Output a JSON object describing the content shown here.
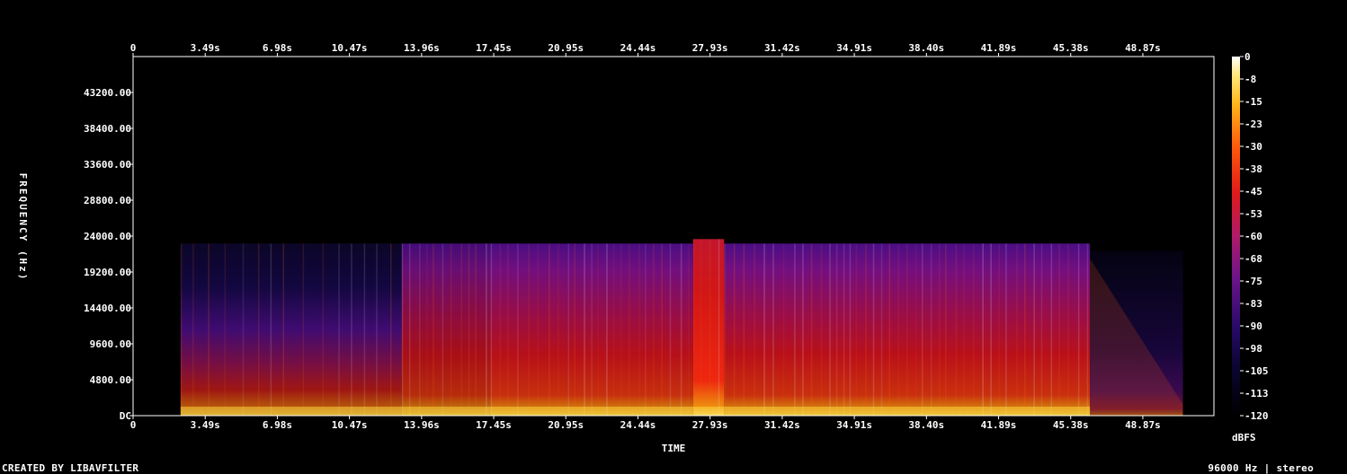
{
  "chart_data": {
    "type": "heatmap",
    "title": "",
    "xlabel": "TIME",
    "ylabel": "FREQUENCY (Hz)",
    "colorbar_label": "dBFS",
    "x_top_ticks": [
      "0",
      "3.49s",
      "6.98s",
      "10.47s",
      "13.96s",
      "17.45s",
      "20.95s",
      "24.44s",
      "27.93s",
      "31.42s",
      "34.91s",
      "38.40s",
      "41.89s",
      "45.38s",
      "48.87s"
    ],
    "x_bottom_ticks": [
      "0",
      "3.49s",
      "6.98s",
      "10.47s",
      "13.96s",
      "17.45s",
      "20.95s",
      "24.44s",
      "27.93s",
      "31.42s",
      "34.91s",
      "38.40s",
      "41.89s",
      "45.38s",
      "48.87s"
    ],
    "x_range": [
      0,
      52.3
    ],
    "y_ticks": [
      "DC",
      "4800.00",
      "9600.00",
      "14400.00",
      "19200.00",
      "24000.00",
      "28800.00",
      "33600.00",
      "38400.00",
      "43200.00"
    ],
    "y_range": [
      0,
      48000
    ],
    "color_range": [
      -120,
      0
    ],
    "colorbar_ticks": [
      "0",
      "-8",
      "-15",
      "-23",
      "-30",
      "-38",
      "-45",
      "-53",
      "-60",
      "-68",
      "-75",
      "-83",
      "-90",
      "-98",
      "-105",
      "-113",
      "-120"
    ],
    "segments": [
      {
        "start": 2.3,
        "end": 13.0,
        "level": 0.55,
        "cutoff_hz": 23000,
        "note": "sparse hits"
      },
      {
        "start": 13.0,
        "end": 17.3,
        "level": 0.62,
        "cutoff_hz": 23000
      },
      {
        "start": 17.3,
        "end": 27.1,
        "level": 0.72,
        "cutoff_hz": 23000
      },
      {
        "start": 27.1,
        "end": 28.6,
        "level": 0.9,
        "cutoff_hz": 23600
      },
      {
        "start": 28.6,
        "end": 46.3,
        "level": 0.74,
        "cutoff_hz": 23000
      },
      {
        "start": 46.3,
        "end": 50.8,
        "level": 0.3,
        "cutoff_hz": 22000,
        "note": "fade out"
      }
    ]
  },
  "footer": {
    "left": "CREATED BY LIBAVFILTER",
    "right": "96000 Hz | stereo"
  }
}
